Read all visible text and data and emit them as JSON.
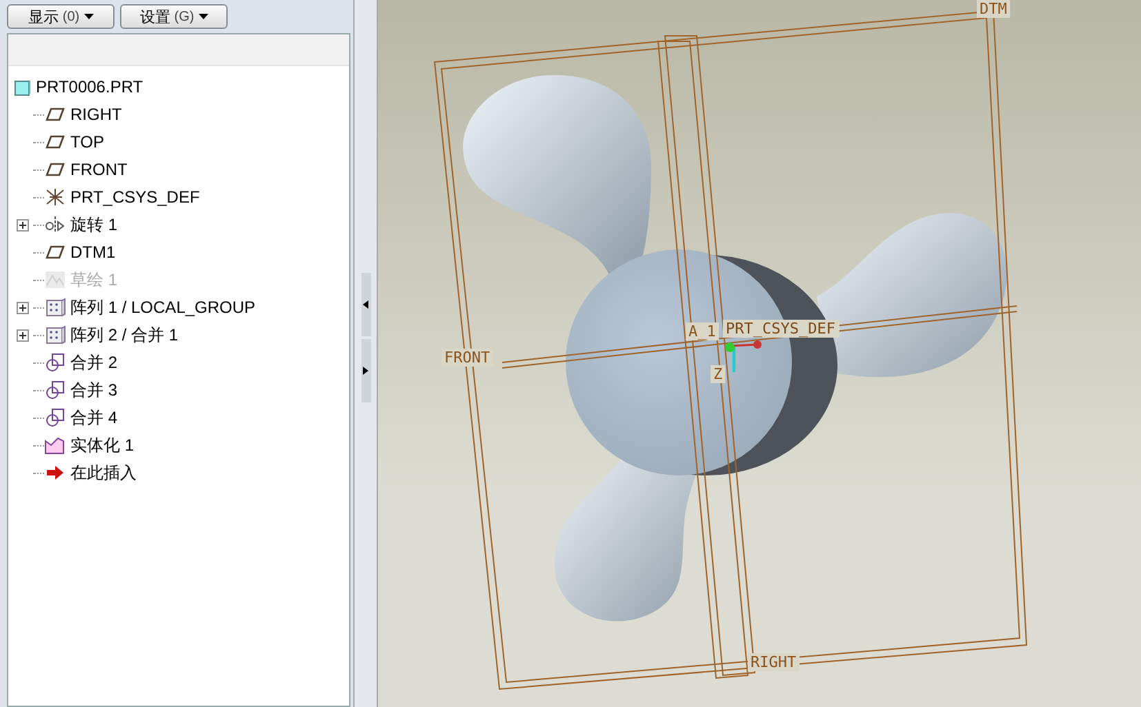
{
  "toolbar": {
    "buttons": [
      {
        "label": "显示",
        "shortcut": "(0)"
      },
      {
        "label": "设置",
        "shortcut": "(G)"
      }
    ]
  },
  "model_tree": {
    "root": {
      "label": "PRT0006.PRT",
      "kind": "part"
    },
    "items": [
      {
        "label": "RIGHT",
        "kind": "plane",
        "expandable": false,
        "disabled": false
      },
      {
        "label": "TOP",
        "kind": "plane",
        "expandable": false,
        "disabled": false
      },
      {
        "label": "FRONT",
        "kind": "plane",
        "expandable": false,
        "disabled": false
      },
      {
        "label": "PRT_CSYS_DEF",
        "kind": "csys",
        "expandable": false,
        "disabled": false
      },
      {
        "label": "旋转 1",
        "kind": "revolve",
        "expandable": true,
        "disabled": false
      },
      {
        "label": "DTM1",
        "kind": "plane",
        "expandable": false,
        "disabled": false
      },
      {
        "label": "草绘 1",
        "kind": "sketch",
        "expandable": false,
        "disabled": true
      },
      {
        "label": "阵列 1 / LOCAL_GROUP",
        "kind": "pattern",
        "expandable": true,
        "disabled": false
      },
      {
        "label": "阵列 2 / 合并 1",
        "kind": "pattern",
        "expandable": true,
        "disabled": false
      },
      {
        "label": "合并 2",
        "kind": "merge",
        "expandable": false,
        "disabled": false
      },
      {
        "label": "合并 3",
        "kind": "merge",
        "expandable": false,
        "disabled": false
      },
      {
        "label": "合并 4",
        "kind": "merge",
        "expandable": false,
        "disabled": false
      },
      {
        "label": "实体化 1",
        "kind": "solidify",
        "expandable": false,
        "disabled": false
      },
      {
        "label": "在此插入",
        "kind": "insert",
        "expandable": false,
        "disabled": false
      }
    ]
  },
  "viewport": {
    "labels": [
      {
        "text": "DTM",
        "kind": "plane"
      },
      {
        "text": "FRONT",
        "kind": "plane"
      },
      {
        "text": "A_1",
        "kind": "axis"
      },
      {
        "text": "PRT_CSYS_DEF",
        "kind": "csys"
      },
      {
        "text": "Z",
        "kind": "axis"
      },
      {
        "text": "RIGHT",
        "kind": "plane"
      }
    ]
  }
}
